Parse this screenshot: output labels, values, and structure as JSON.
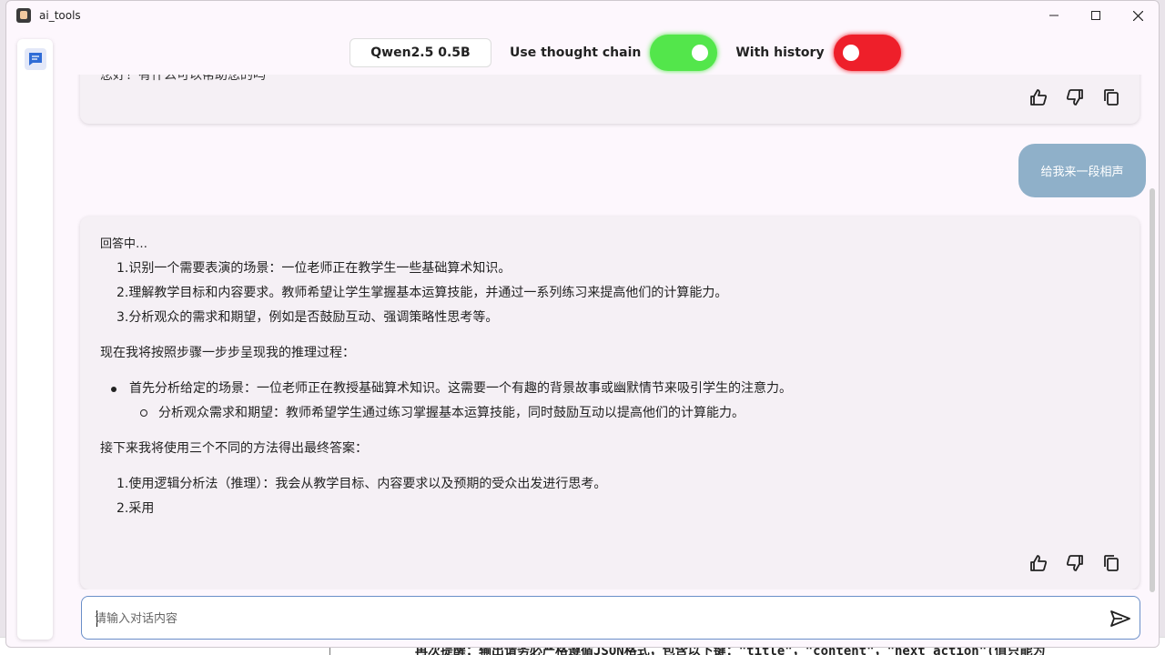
{
  "window": {
    "title": "ai_tools"
  },
  "topbar": {
    "model": "Qwen2.5 0.5B",
    "thought_chain_label": "Use thought chain",
    "thought_chain_on": true,
    "history_label": "With history",
    "history_on": false
  },
  "chat": {
    "prev_tail": "您好！有什么可以帮助您的吗",
    "user_message": "给我来一段相声",
    "reply": {
      "status": "回答中…",
      "steps": [
        "1.识别一个需要表演的场景：一位老师正在教学生一些基础算术知识。",
        "2.理解教学目标和内容要求。教师希望让学生掌握基本运算技能，并通过一系列练习来提高他们的计算能力。",
        "3.分析观众的需求和期望，例如是否鼓励互动、强调策略性思考等。"
      ],
      "intro": "现在我将按照步骤一步步呈现我的推理过程：",
      "bullet": "首先分析给定的场景：一位老师正在教授基础算术知识。这需要一个有趣的背景故事或幽默情节来吸引学生的注意力。",
      "sub_bullet": "分析观众需求和期望：教师希望学生通过练习掌握基本运算技能，同时鼓励互动以提高他们的计算能力。",
      "next": "接下来我将使用三个不同的方法得出最终答案：",
      "methods": [
        "1.使用逻辑分析法（推理）：我会从教学目标、内容要求以及预期的受众出发进行思考。",
        "2.采用"
      ]
    }
  },
  "input": {
    "placeholder": "请输入对话内容"
  },
  "background": {
    "text": "再次提醒：输出请务必严格遵循JSON格式，包含以下键：\"title\"，\"content\"，\"next_action\"(值只能为"
  },
  "colors": {
    "toggle_on": "#53e64b",
    "toggle_off": "#ee1f2a",
    "user_bubble": "#8fb0c9",
    "accent": "#2f6cd6"
  }
}
